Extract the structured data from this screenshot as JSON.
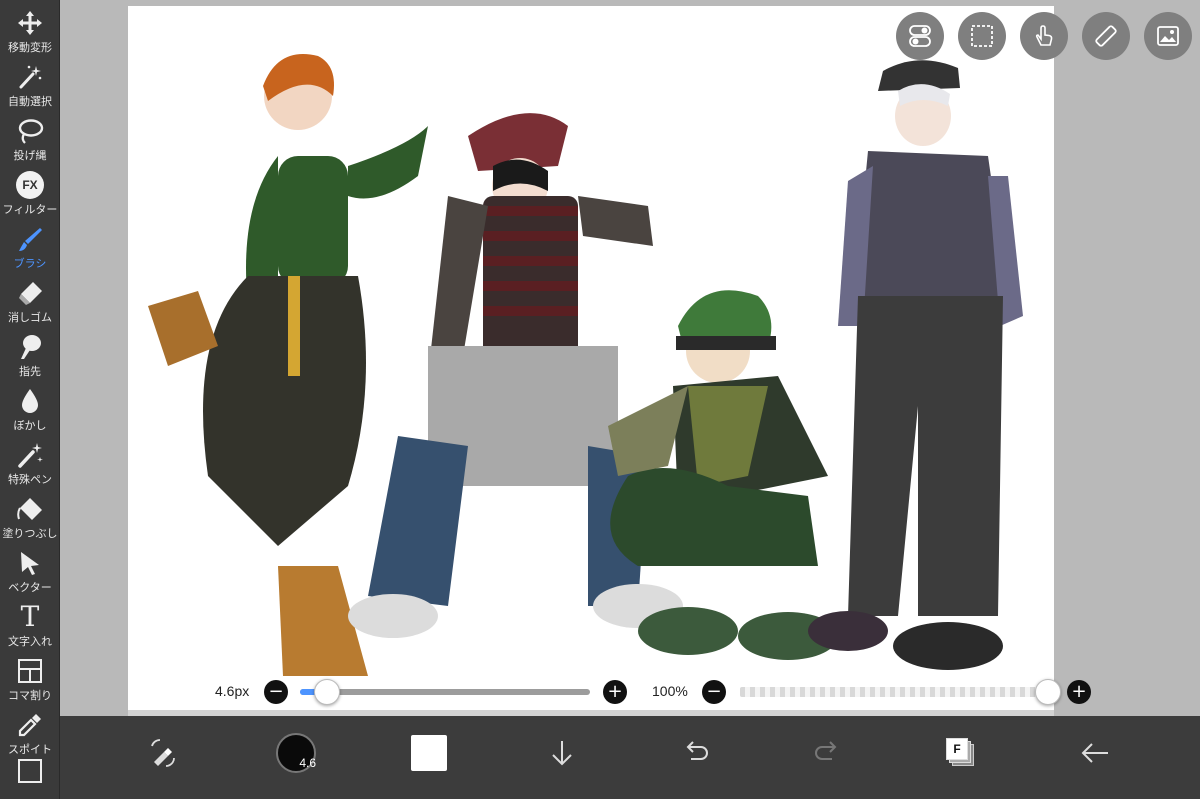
{
  "toolbar": {
    "items": [
      {
        "label": "移動変形",
        "icon": "move-arrows-icon"
      },
      {
        "label": "自動選択",
        "icon": "magic-wand-icon"
      },
      {
        "label": "投げ縄",
        "icon": "lasso-icon"
      },
      {
        "label": "フィルター",
        "icon": "fx-icon"
      },
      {
        "label": "ブラシ",
        "icon": "brush-icon",
        "active": true
      },
      {
        "label": "消しゴム",
        "icon": "eraser-icon"
      },
      {
        "label": "指先",
        "icon": "smudge-finger-icon"
      },
      {
        "label": "ぼかし",
        "icon": "blur-drop-icon"
      },
      {
        "label": "特殊ペン",
        "icon": "special-pen-icon"
      },
      {
        "label": "塗りつぶし",
        "icon": "fill-bucket-icon"
      },
      {
        "label": "ベクター",
        "icon": "vector-arrow-icon"
      },
      {
        "label": "文字入れ",
        "icon": "text-t-icon"
      },
      {
        "label": "コマ割り",
        "icon": "frame-divider-icon"
      },
      {
        "label": "スポイト",
        "icon": "eyedropper-icon"
      },
      {
        "label": "",
        "icon": "canvas-icon"
      }
    ],
    "fx_text": "FX",
    "t_text": "T"
  },
  "top_buttons": [
    "toggle-switch-icon",
    "selection-icon",
    "touch-gesture-icon",
    "ruler-icon",
    "image-layer-icon"
  ],
  "brush_size": {
    "label": "4.6px",
    "value": 4.6,
    "slider_fraction": 0.05
  },
  "brush_opacity": {
    "label": "100%",
    "value": 100
  },
  "bottom_bar": {
    "items": [
      "transform-tool-icon",
      "brush-size-icon",
      "color-swatch-icon",
      "download-icon",
      "undo-icon",
      "redo-icon",
      "layer-icon",
      "back-arrow-icon"
    ],
    "brush_size_badge": "4.6",
    "layer_badge": "F"
  },
  "colors": {
    "accent": "#4d94ff",
    "toolbar_bg": "#3a3a3a",
    "bottom_bg": "#3c3c3c",
    "canvas_bg": "#ffffff"
  }
}
